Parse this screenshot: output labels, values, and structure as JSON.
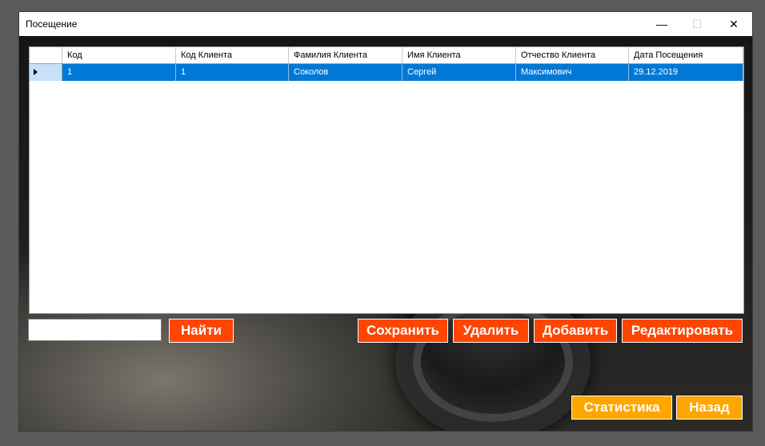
{
  "window": {
    "title": "Посещение",
    "minimize_glyph": "—",
    "maximize_glyph": "☐",
    "close_glyph": "✕"
  },
  "grid": {
    "columns": [
      "Код",
      "Код Клиента",
      "Фамилия Клиента",
      "Имя Клиента",
      "Отчество Клиента",
      "Дата Посещения"
    ],
    "rows": [
      [
        "1",
        "1",
        "Соколов",
        "Сергей",
        "Максимович",
        "29.12.2019"
      ]
    ],
    "selected_row_color": "#0078d7"
  },
  "search": {
    "value": "",
    "button_label": "Найти"
  },
  "actions": {
    "save_label": "Сохранить",
    "delete_label": "Удалить",
    "add_label": "Добавить",
    "edit_label": "Редактировать"
  },
  "nav": {
    "stats_label": "Статистика",
    "back_label": "Назад"
  },
  "colors": {
    "action_button": "#ff4500",
    "nav_button": "#ffa500"
  }
}
